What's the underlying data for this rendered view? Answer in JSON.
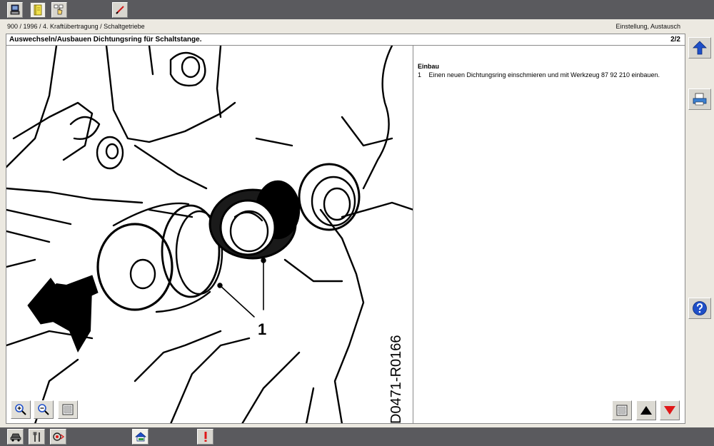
{
  "breadcrumb": {
    "path": "900 / 1996 / 4. Kraftübertragung / Schaltgetriebe",
    "right": "Einstellung, Austausch"
  },
  "document": {
    "title": "Auswechseln/Ausbauen Dichtungsring für Schaltstange.",
    "page": "2/2"
  },
  "figure": {
    "callout_label": "1",
    "drawing_id": "D0471-R0166"
  },
  "instructions": {
    "heading": "Einbau",
    "steps": [
      {
        "number": "1",
        "text": "Einen neuen Dichtungsring einschmieren und mit Werkzeug 87 92 210 einbauen."
      }
    ]
  },
  "toolbar": {
    "icons": [
      "computer-icon",
      "book-icon",
      "hand-pointer-icon",
      "pen-icon"
    ]
  },
  "sidebar": {
    "icons": [
      "arrow-up-icon",
      "print-icon",
      "help-icon"
    ]
  },
  "colors": {
    "chrome": "#5a5a5e",
    "panel": "#ece9e1",
    "accent_blue": "#1e4fc8",
    "alert_red": "#e01818"
  }
}
